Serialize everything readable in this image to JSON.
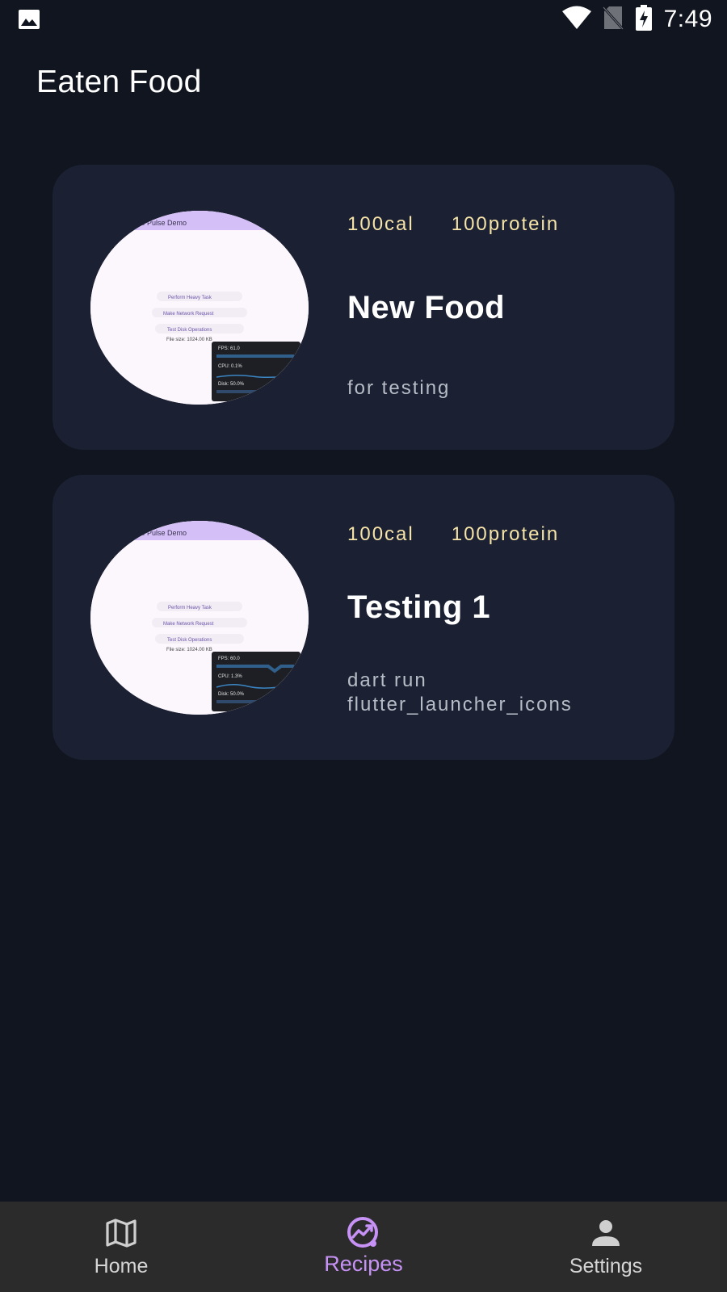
{
  "status_bar": {
    "time": "7:49",
    "left_icon": "image-icon",
    "right_icons": [
      "wifi-icon",
      "no-sim-icon",
      "battery-charging-icon"
    ]
  },
  "header": {
    "title": "Eaten Food"
  },
  "foods": [
    {
      "calories": "100cal",
      "protein": "100protein",
      "name": "New Food",
      "description": "for testing",
      "thumbnail": {
        "app_bar_text": "ance Pulse Demo",
        "buttons": [
          "Perform Heavy Task",
          "Make Network Request",
          "Test Disk Operations"
        ],
        "file_size": "File size: 1024.00 KB",
        "fps": "FPS: 61.0",
        "cpu": "CPU: 0.1%",
        "disk": "Disk: 50.0%"
      }
    },
    {
      "calories": "100cal",
      "protein": "100protein",
      "name": "Testing 1",
      "description": "dart run flutter_launcher_icons",
      "thumbnail": {
        "app_bar_text": "ance Pulse Demo",
        "buttons": [
          "Perform Heavy Task",
          "Make Network Request",
          "Test Disk Operations"
        ],
        "file_size": "File size: 1024.00 KB",
        "fps": "FPS: 60.0",
        "cpu": "CPU: 1.3%",
        "disk": "Disk: 50.0%"
      }
    }
  ],
  "bottom_nav": {
    "items": [
      {
        "label": "Home",
        "icon": "map-icon",
        "active": false
      },
      {
        "label": "Recipes",
        "icon": "trending-chart-icon",
        "active": true
      },
      {
        "label": "Settings",
        "icon": "person-icon",
        "active": false
      }
    ]
  },
  "colors": {
    "background": "#11151f",
    "card": "#1b2133",
    "macro_text": "#f5e3a7",
    "active_nav": "#c792f5",
    "nav_bar": "#2b2b2b"
  }
}
